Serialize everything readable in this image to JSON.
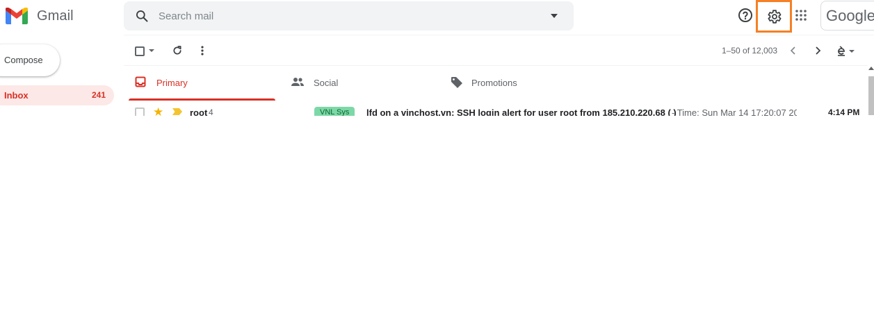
{
  "header": {
    "app_name": "Gmail",
    "search": {
      "placeholder": "Search mail",
      "value": ""
    },
    "account_brand": "Google",
    "icons": {
      "logo": "gmail-m-logo",
      "search": "search-icon",
      "search_options": "caret-down-icon",
      "help": "help-circle-icon",
      "settings": "gear-icon",
      "apps": "apps-grid-icon"
    },
    "highlight_color": "#f58025"
  },
  "sidebar": {
    "compose_label": "Compose",
    "items": [
      {
        "label": "Inbox",
        "count": "241"
      }
    ]
  },
  "toolbar": {
    "pagination": "1–50 of 12,003",
    "icons": [
      "checkbox-icon",
      "caret-down-icon",
      "refresh-icon",
      "more-vert-icon",
      "chevron-left-icon",
      "chevron-right-icon",
      "input-tools-icon"
    ]
  },
  "tabs": [
    {
      "label": "Primary",
      "icon": "inbox-tab-icon",
      "active": true
    },
    {
      "label": "Social",
      "icon": "people-icon",
      "active": false
    },
    {
      "label": "Promotions",
      "icon": "tag-icon",
      "active": false
    }
  ],
  "emails": [
    {
      "sender": "root",
      "thread_count": "4",
      "label": "VNL Sys",
      "subject": "lfd on a vinchost.vn: SSH login alert for user root from 185.210.220.68 ( )",
      "snippet": "- Time: Sun Mar 14 17:20:07 20",
      "time": "4:14 PM"
    }
  ],
  "colors": {
    "accent_red": "#d93025",
    "inbox_bg": "#fce8e6",
    "label_green": "#7dd8a8"
  }
}
